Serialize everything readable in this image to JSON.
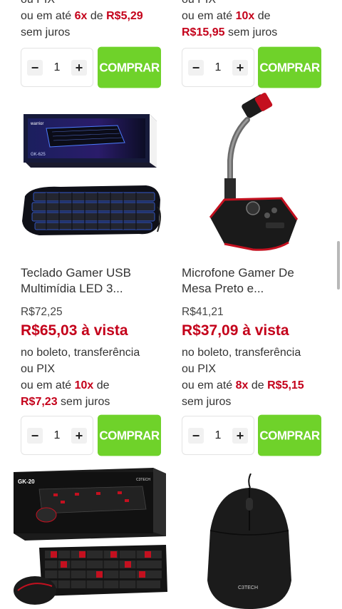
{
  "top": {
    "left": {
      "cut_line": "ou PIX",
      "installment_prefix": "ou em até",
      "installment_count": "6x",
      "installment_of": "de",
      "installment_value": "R$5,29",
      "no_interest": "sem juros"
    },
    "right": {
      "cut_line": "ou PIX",
      "installment_prefix": "ou em até",
      "installment_count": "10x",
      "installment_of": "de",
      "installment_value": "R$15,95",
      "no_interest": "sem juros"
    }
  },
  "products": [
    {
      "name_line1": "Teclado Gamer USB",
      "name_line2": "Multimídia LED 3...",
      "old_price": "R$72,25",
      "cash_price": "R$65,03 à vista",
      "payment_line1": "no boleto, transferência",
      "payment_line2": "ou PIX",
      "installment_prefix": "ou em até",
      "installment_count": "10x",
      "installment_of": "de",
      "installment_value": "R$7,23",
      "no_interest": "sem juros"
    },
    {
      "name_line1": "Microfone Gamer De",
      "name_line2": "Mesa Preto e...",
      "old_price": "R$41,21",
      "cash_price": "R$37,09 à vista",
      "payment_line1": "no boleto, transferência",
      "payment_line2": "ou PIX",
      "installment_prefix": "ou em até",
      "installment_count": "8x",
      "installment_of": "de",
      "installment_value": "R$5,15",
      "no_interest": "sem juros"
    }
  ],
  "controls": {
    "minus": "−",
    "plus": "+",
    "quantity": "1",
    "buy_label": "COMPRAR"
  },
  "box_texts": {
    "keyboard_box_model": "GK-625",
    "keyboard_box_brand": "warrior",
    "combo_box_model": "GK-20",
    "combo_box_brand": "C3TECH",
    "mouse_brand": "C3TECH"
  },
  "colors": {
    "price_red": "#c4001a",
    "buy_green": "#6fd22a"
  }
}
